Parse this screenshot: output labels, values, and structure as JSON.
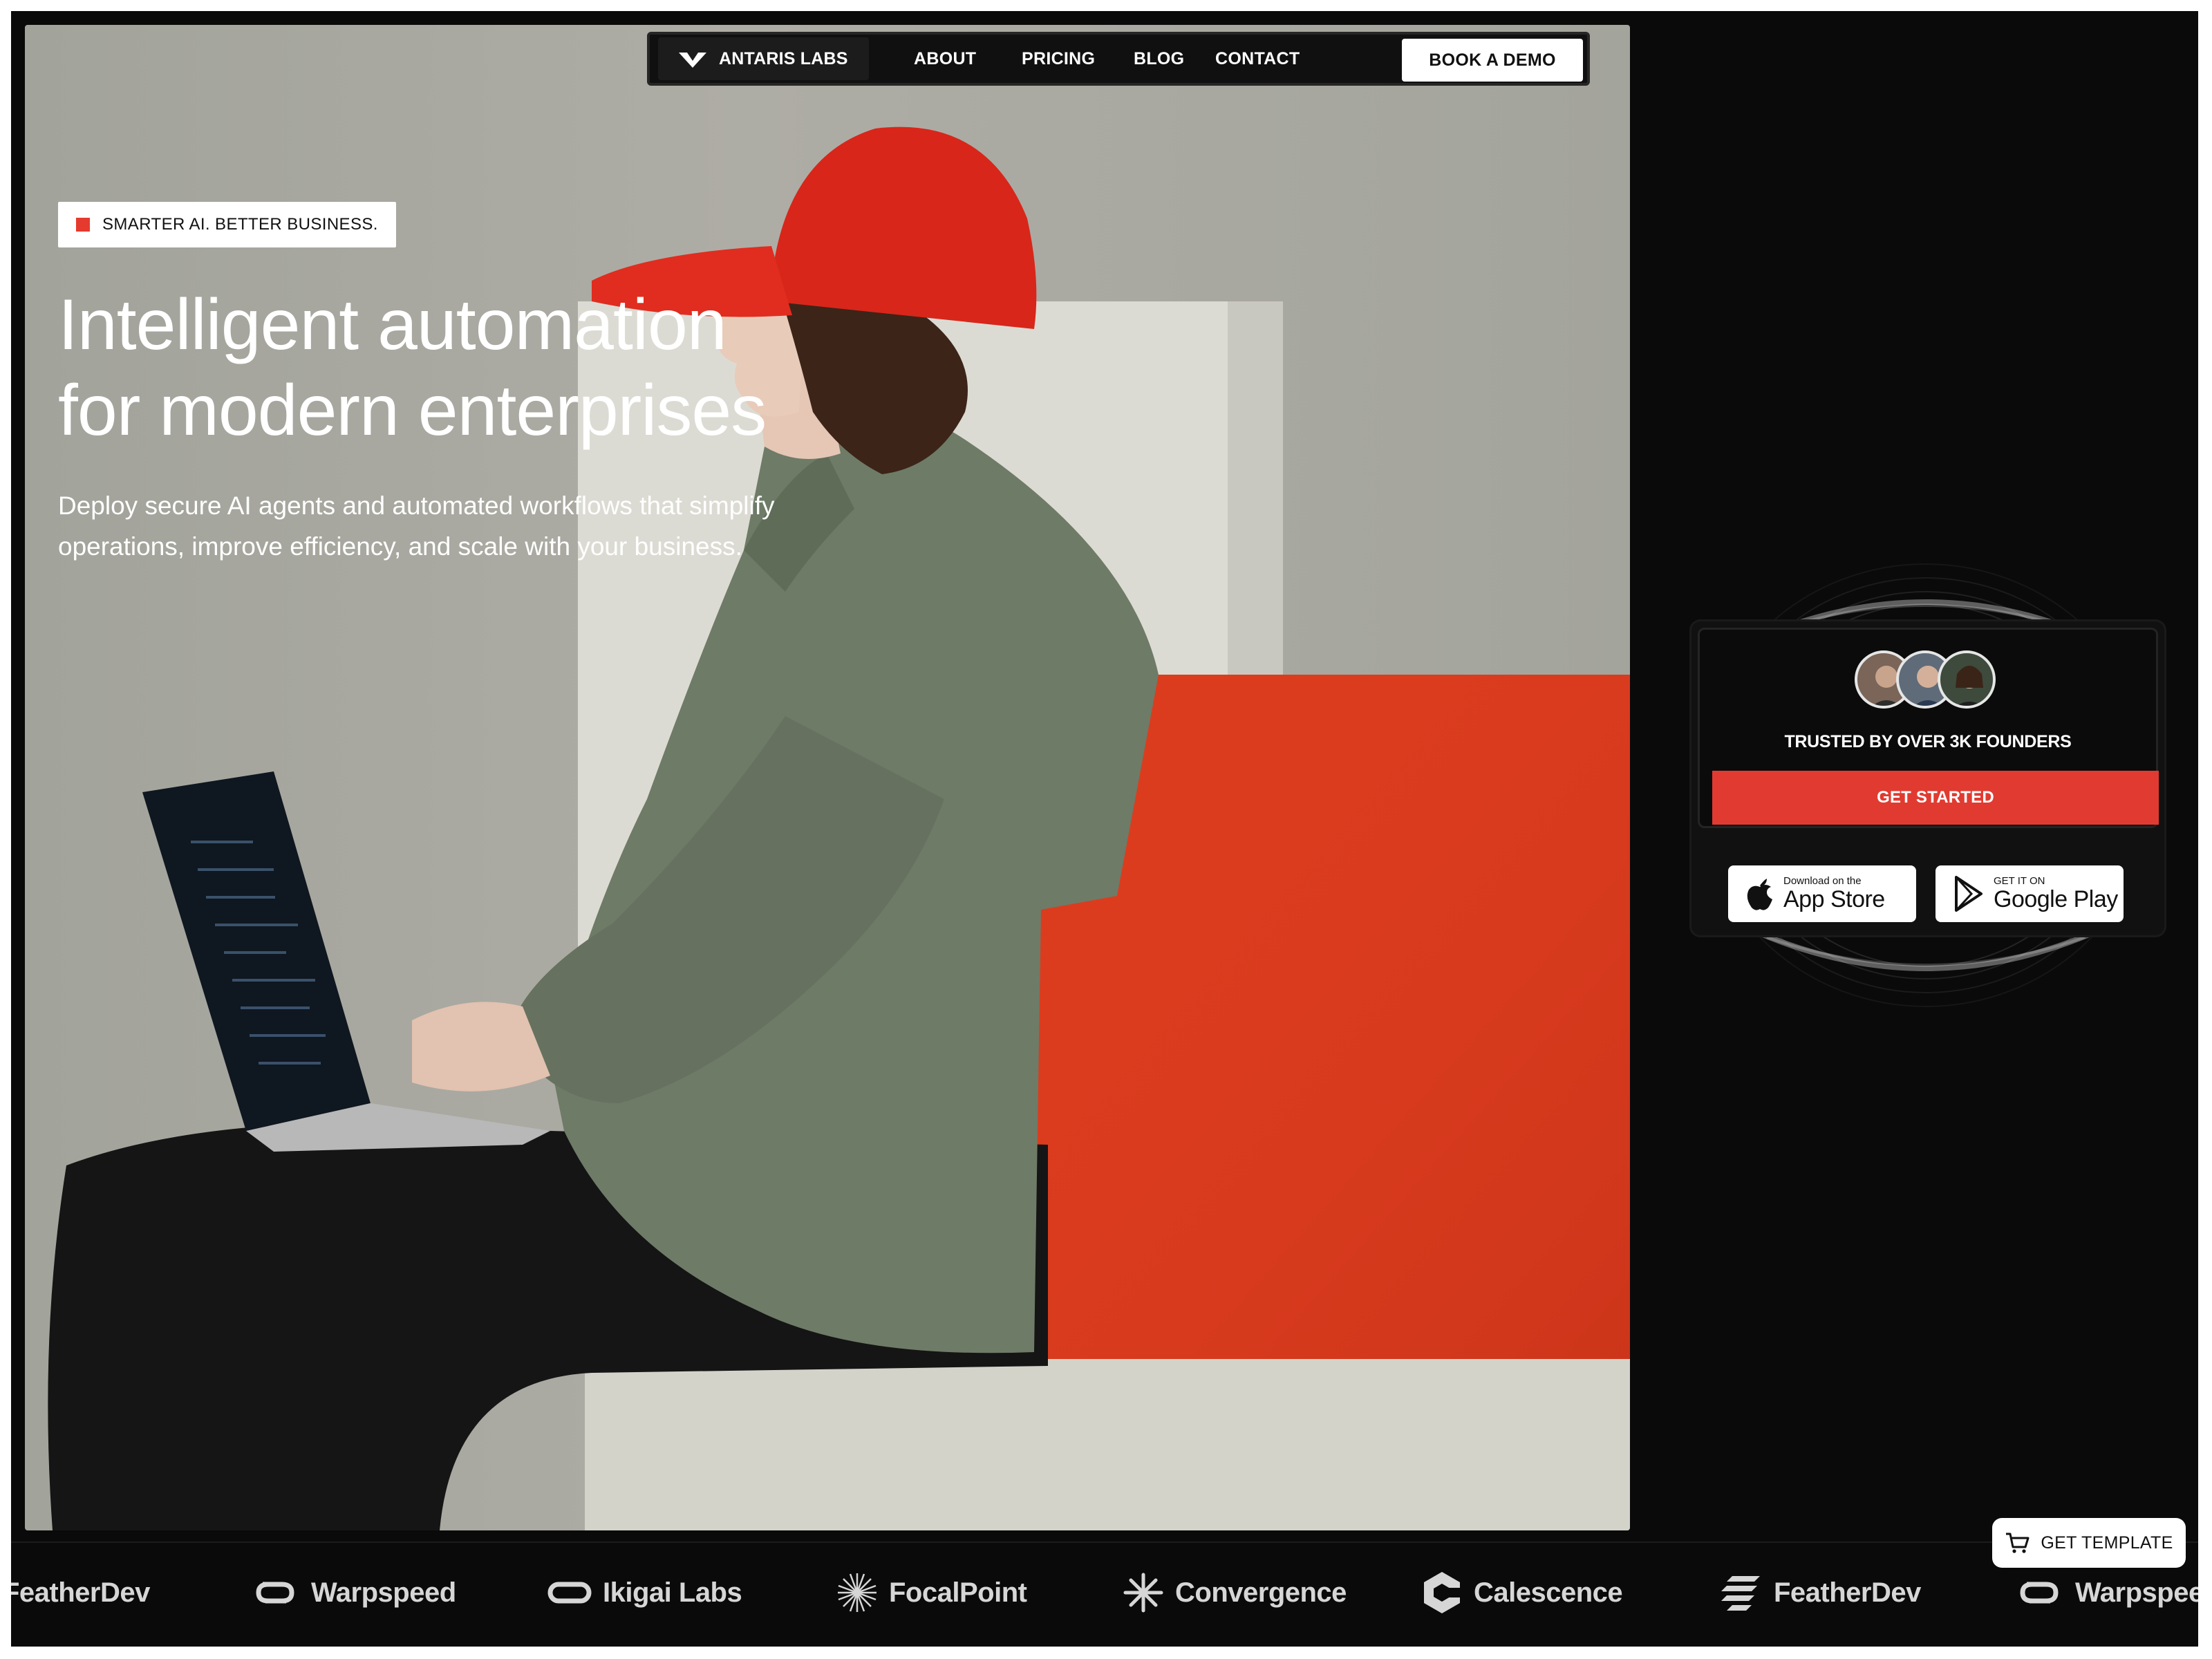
{
  "nav": {
    "brand": "ANTARIS LABS",
    "links": [
      "ABOUT",
      "PRICING",
      "BLOG",
      "CONTACT"
    ],
    "cta": "BOOK A DEMO"
  },
  "hero": {
    "tagline": "SMARTER AI. BETTER BUSINESS.",
    "headline_line1": "Intelligent automation",
    "headline_line2": "for modern enterprises",
    "subtitle_line1": "Deploy secure AI agents and automated workflows that simplify",
    "subtitle_line2": "operations, improve efficiency, and scale with your business."
  },
  "card": {
    "trusted": "TRUSTED BY OVER 3K FOUNDERS",
    "cta": "GET STARTED",
    "app_store": {
      "small": "Download on the",
      "big": "App Store"
    },
    "google_play": {
      "small": "GET IT ON",
      "big": "Google Play"
    }
  },
  "logos": [
    "FeatherDev",
    "Warpspeed",
    "Ikigai Labs",
    "FocalPoint",
    "Convergence",
    "Calescence",
    "FeatherDev",
    "Warpspeed"
  ],
  "template_button": "GET TEMPLATE",
  "colors": {
    "accent": "#e13b31",
    "background": "#0a0a0a",
    "hero_bg": "#a8a8a0"
  }
}
